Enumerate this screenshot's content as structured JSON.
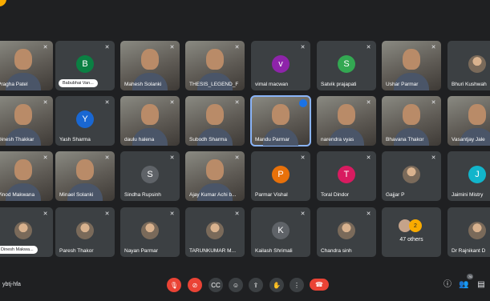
{
  "meeting": {
    "code": "ybtj-hfa"
  },
  "participants": [
    {
      "name": "Pragha Patel",
      "type": "video",
      "col": 0,
      "row": 0
    },
    {
      "name": "Babubhai Van...",
      "type": "avatar",
      "initial": "B",
      "color": "#0b8043",
      "pill": true,
      "col": 1,
      "row": 0
    },
    {
      "name": "Mahesh Solanki",
      "type": "video",
      "col": 2,
      "row": 0
    },
    {
      "name": "THESIS_LEGEND_F",
      "type": "video",
      "col": 3,
      "row": 0
    },
    {
      "name": "vimal macwan",
      "type": "avatar",
      "initial": "v",
      "color": "#8e24aa",
      "col": 4,
      "row": 0
    },
    {
      "name": "Satvik prajapati",
      "type": "avatar",
      "initial": "S",
      "color": "#33a852",
      "col": 5,
      "row": 0
    },
    {
      "name": "Ushar Parmar",
      "type": "video",
      "col": 6,
      "row": 0
    },
    {
      "name": "Bhuri Kushwah",
      "type": "photo",
      "col": 7,
      "row": 0
    },
    {
      "name": "Dinesh Thakkar",
      "type": "video",
      "col": 0,
      "row": 1
    },
    {
      "name": "Yash Sharma",
      "type": "avatar",
      "initial": "Y",
      "color": "#1967d2",
      "col": 1,
      "row": 1
    },
    {
      "name": "daulu halena",
      "type": "video",
      "col": 2,
      "row": 1
    },
    {
      "name": "Subodh Sharma",
      "type": "video",
      "col": 3,
      "row": 1
    },
    {
      "name": "Mandu Parmar",
      "type": "video",
      "active": true,
      "col": 4,
      "row": 1
    },
    {
      "name": "narendra vyas",
      "type": "video",
      "col": 5,
      "row": 1
    },
    {
      "name": "Bhavana Thakor",
      "type": "video",
      "col": 6,
      "row": 1
    },
    {
      "name": "Vasantjay Jale",
      "type": "video",
      "col": 7,
      "row": 1
    },
    {
      "name": "Vinod Makwana",
      "type": "video",
      "col": 0,
      "row": 2
    },
    {
      "name": "Minael Solanki",
      "type": "video",
      "col": 1,
      "row": 2
    },
    {
      "name": "Sindha Rupsinh",
      "type": "avatar",
      "initial": "S",
      "color": "#5f6368",
      "col": 2,
      "row": 2
    },
    {
      "name": "Ajay Kumar Achi b...",
      "type": "video",
      "col": 3,
      "row": 2
    },
    {
      "name": "Parmar Vishal",
      "type": "avatar",
      "initial": "P",
      "color": "#e8710a",
      "col": 4,
      "row": 2
    },
    {
      "name": "Toral Dindor",
      "type": "avatar",
      "initial": "T",
      "color": "#d81b60",
      "col": 5,
      "row": 2
    },
    {
      "name": "Gajjar P",
      "type": "photo",
      "col": 6,
      "row": 2
    },
    {
      "name": "Jaimini Mistry",
      "type": "avatar",
      "initial": "J",
      "color": "#12b5cb",
      "col": 7,
      "row": 2
    },
    {
      "name": "Dinesh Makwa...",
      "type": "photo",
      "pill": true,
      "col": 0,
      "row": 3
    },
    {
      "name": "Paresh Thakor",
      "type": "photo",
      "col": 1,
      "row": 3
    },
    {
      "name": "Nayan Parmar",
      "type": "photo",
      "col": 2,
      "row": 3
    },
    {
      "name": "TARUNKUMAR M...",
      "type": "photo",
      "col": 3,
      "row": 3
    },
    {
      "name": "Kailash Shrimali",
      "type": "avatar",
      "initial": "K",
      "color": "#5f6368",
      "col": 4,
      "row": 3
    },
    {
      "name": "Chandra sinh",
      "type": "photo",
      "col": 5,
      "row": 3
    },
    {
      "name": "47 others",
      "type": "others",
      "col": 6,
      "row": 3
    },
    {
      "name": "Dr Rajnikant D",
      "type": "photo",
      "col": 7,
      "row": 3
    }
  ],
  "others_avatar_count": "2",
  "controls": [
    {
      "name": "mic-off-button",
      "glyph": "🎙",
      "red": true
    },
    {
      "name": "camera-off-button",
      "glyph": "⊘",
      "red": true
    },
    {
      "name": "captions-button",
      "glyph": "CC",
      "red": false
    },
    {
      "name": "emoji-button",
      "glyph": "☺",
      "red": false
    },
    {
      "name": "present-button",
      "glyph": "⇪",
      "red": false
    },
    {
      "name": "raise-hand-button",
      "glyph": "✋",
      "red": false
    },
    {
      "name": "more-options-button",
      "glyph": "⋮",
      "red": false
    },
    {
      "name": "leave-call-button",
      "glyph": "☎",
      "end": true
    }
  ],
  "right_controls": {
    "info": "ⓘ",
    "people": "👥",
    "chat": "▤",
    "people_badge": "76"
  }
}
